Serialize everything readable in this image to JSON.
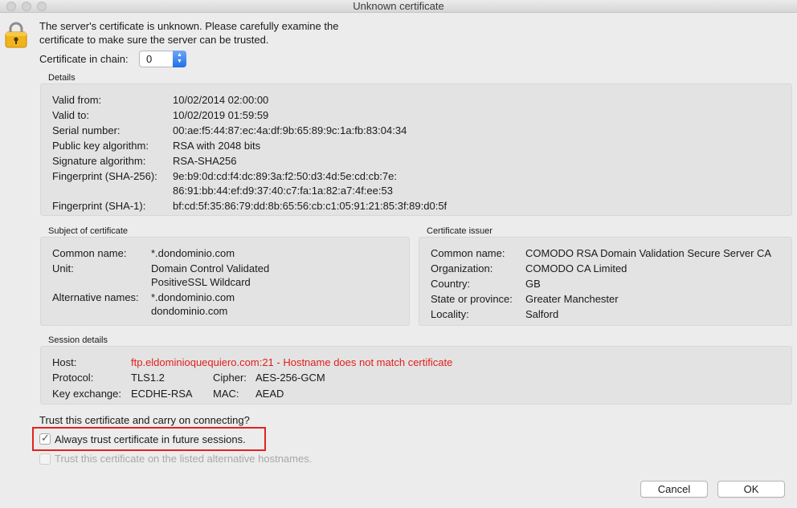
{
  "window": {
    "title": "Unknown certificate"
  },
  "intro": "The server's certificate is unknown. Please carefully examine the certificate to make sure the server can be trusted.",
  "chain": {
    "label": "Certificate in chain:",
    "value": "0"
  },
  "details": {
    "label": "Details",
    "rows": [
      {
        "k": "Valid from:",
        "v": "10/02/2014 02:00:00"
      },
      {
        "k": "Valid to:",
        "v": "10/02/2019 01:59:59"
      },
      {
        "k": "Serial number:",
        "v": "00:ae:f5:44:87:ec:4a:df:9b:65:89:9c:1a:fb:83:04:34"
      },
      {
        "k": "Public key algorithm:",
        "v": "RSA with 2048 bits"
      },
      {
        "k": "Signature algorithm:",
        "v": "RSA-SHA256"
      },
      {
        "k": "Fingerprint (SHA-256):",
        "v": "9e:b9:0d:cd:f4:dc:89:3a:f2:50:d3:4d:5e:cd:cb:7e:",
        "v2": "86:91:bb:44:ef:d9:37:40:c7:fa:1a:82:a7:4f:ee:53"
      },
      {
        "k": "Fingerprint (SHA-1):",
        "v": "bf:cd:5f:35:86:79:dd:8b:65:56:cb:c1:05:91:21:85:3f:89:d0:5f"
      }
    ]
  },
  "subject": {
    "label": "Subject of certificate",
    "common_name_k": "Common name:",
    "common_name_v": "*.dondominio.com",
    "unit_k": "Unit:",
    "unit_v1": "Domain Control Validated",
    "unit_v2": "PositiveSSL Wildcard",
    "alt_k": "Alternative names:",
    "alt_v1": "*.dondominio.com",
    "alt_v2": "dondominio.com"
  },
  "issuer": {
    "label": "Certificate issuer",
    "rows": [
      {
        "k": "Common name:",
        "v": "COMODO RSA Domain Validation Secure Server CA"
      },
      {
        "k": "Organization:",
        "v": "COMODO CA Limited"
      },
      {
        "k": "Country:",
        "v": "GB"
      },
      {
        "k": "State or province:",
        "v": "Greater Manchester"
      },
      {
        "k": "Locality:",
        "v": "Salford"
      }
    ]
  },
  "session": {
    "label": "Session details",
    "host_k": "Host:",
    "host_v": "ftp.eldominioquequiero.com:21 - Hostname does not match certificate",
    "protocol_k": "Protocol:",
    "protocol_v": "TLS1.2",
    "cipher_k": "Cipher:",
    "cipher_v": "AES-256-GCM",
    "kex_k": "Key exchange:",
    "kex_v": "ECDHE-RSA",
    "mac_k": "MAC:",
    "mac_v": "AEAD"
  },
  "trust": {
    "question": "Trust this certificate and carry on connecting?",
    "always_label": "Always trust certificate in future sessions.",
    "always_checked": true,
    "alt_label": "Trust this certificate on the listed alternative hostnames.",
    "alt_checked": false
  },
  "buttons": {
    "cancel": "Cancel",
    "ok": "OK"
  },
  "colors": {
    "warning": "#e0201c",
    "highlight": "#e32222",
    "stepper": "#1f6fe8"
  }
}
